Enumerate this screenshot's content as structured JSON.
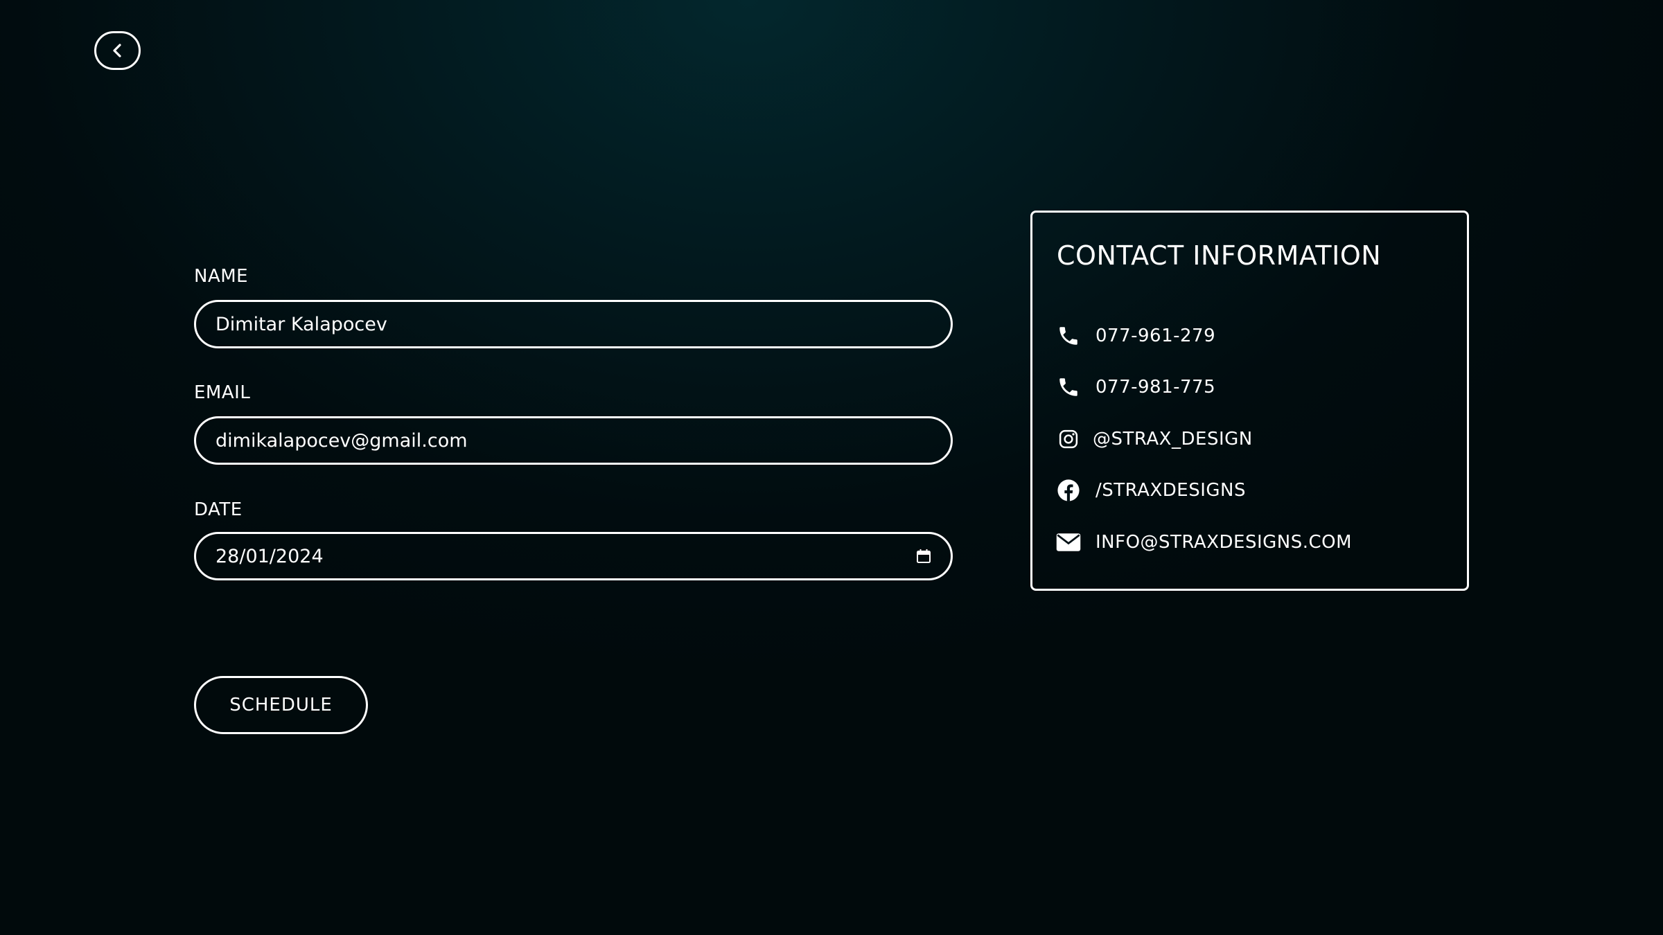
{
  "nav": {
    "back_label": ""
  },
  "form": {
    "name": {
      "label": "NAME",
      "value": "Dimitar Kalapocev"
    },
    "email": {
      "label": "EMAIL",
      "value": "dimikalapocev@gmail.com"
    },
    "date": {
      "label": "DATE",
      "value": "28/01/2024",
      "icon": "calendar-icon"
    },
    "submit_label": "SCHEDULE"
  },
  "contact": {
    "title": "CONTACT INFORMATION",
    "items": [
      {
        "icon": "phone-icon",
        "text": "077-961-279"
      },
      {
        "icon": "phone-icon",
        "text": "077-981-775"
      },
      {
        "icon": "instagram-icon",
        "text": "@STRAX_DESIGN"
      },
      {
        "icon": "facebook-icon",
        "text": "/STRAXDESIGNS"
      },
      {
        "icon": "mail-icon",
        "text": "INFO@STRAXDESIGNS.COM"
      }
    ]
  },
  "colors": {
    "background_dark": "#010c0f",
    "background_glow": "#03272d",
    "foreground": "#ffffff"
  }
}
